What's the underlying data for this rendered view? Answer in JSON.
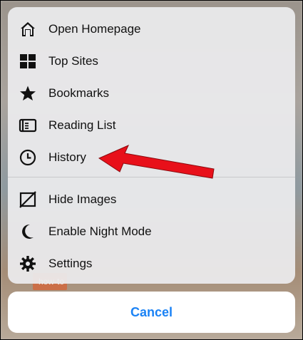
{
  "menu": {
    "items": [
      {
        "label": "Open Homepage",
        "icon": "home-icon"
      },
      {
        "label": "Top Sites",
        "icon": "grid-icon"
      },
      {
        "label": "Bookmarks",
        "icon": "star-icon"
      },
      {
        "label": "Reading List",
        "icon": "book-icon"
      },
      {
        "label": "History",
        "icon": "clock-icon"
      },
      {
        "label": "Hide Images",
        "icon": "no-image-icon"
      },
      {
        "label": "Enable Night Mode",
        "icon": "moon-icon"
      },
      {
        "label": "Settings",
        "icon": "gear-icon"
      }
    ]
  },
  "cancel_label": "Cancel",
  "background_tag": "how-to",
  "colors": {
    "accent": "#1a82f5",
    "arrow": "#e8101a",
    "sheet": "#ececee"
  }
}
